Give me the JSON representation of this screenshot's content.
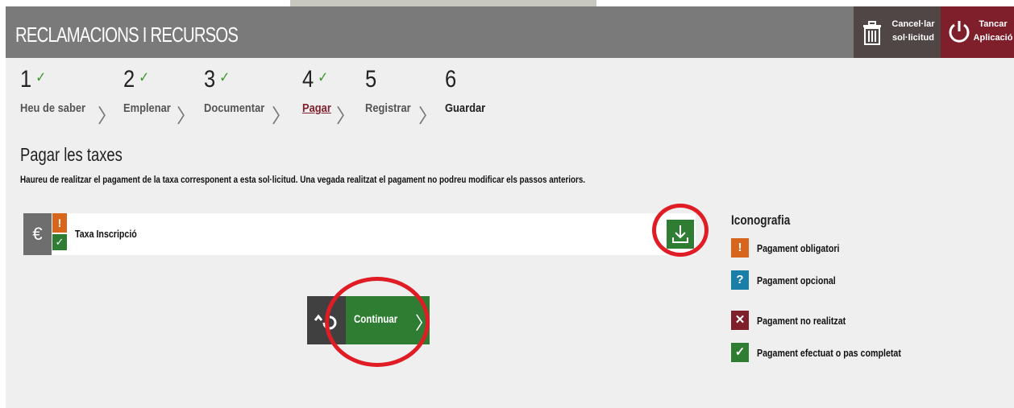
{
  "header": {
    "title": "RECLAMACIONS I RECURSOS",
    "cancel_label_1": "Cancel·lar",
    "cancel_label_2": "sol·licitud",
    "close_label_1": "Tancar",
    "close_label_2": "Aplicació"
  },
  "steps": [
    {
      "number": "1",
      "label": "Heu de saber",
      "done": true
    },
    {
      "number": "2",
      "label": "Emplenar",
      "done": true
    },
    {
      "number": "3",
      "label": "Documentar",
      "done": true
    },
    {
      "number": "4",
      "label": "Pagar",
      "done": true,
      "current": true
    },
    {
      "number": "5",
      "label": "Registrar",
      "done": false
    },
    {
      "number": "6",
      "label": "Guardar",
      "done": false
    }
  ],
  "check_mark": "✓",
  "section": {
    "title": "Pagar les taxes",
    "description": "Haureu de realitzar el pagament de la taxa corresponent a esta sol·licitud. Una vegada realitzat el pagament no podreu modificar els passos anteriors."
  },
  "fee": {
    "currency_symbol": "€",
    "name": "Taxa Inscripció",
    "obligatory_symbol": "!",
    "done_symbol": "✓"
  },
  "iconography": {
    "title": "Iconografia",
    "items": [
      {
        "symbol": "!",
        "label": "Pagament obligatori",
        "color": "#d7661c"
      },
      {
        "symbol": "?",
        "label": "Pagament opcional",
        "color": "#1a7fa8"
      },
      {
        "symbol": "✕",
        "label": "Pagament no realitzat",
        "color": "#7e1f2b"
      },
      {
        "symbol": "✓",
        "label": "Pagament efectuat o pas completat",
        "color": "#2e7d32"
      }
    ]
  },
  "navigation": {
    "continue_label": "Continuar",
    "continue_arrow": "〉"
  },
  "colors": {
    "header_bg": "#7a7a7a",
    "cancel_bg": "#4f4645",
    "close_bg": "#7e1f2b",
    "accent_green": "#2e7d32",
    "highlight_circle": "#e01c24"
  }
}
